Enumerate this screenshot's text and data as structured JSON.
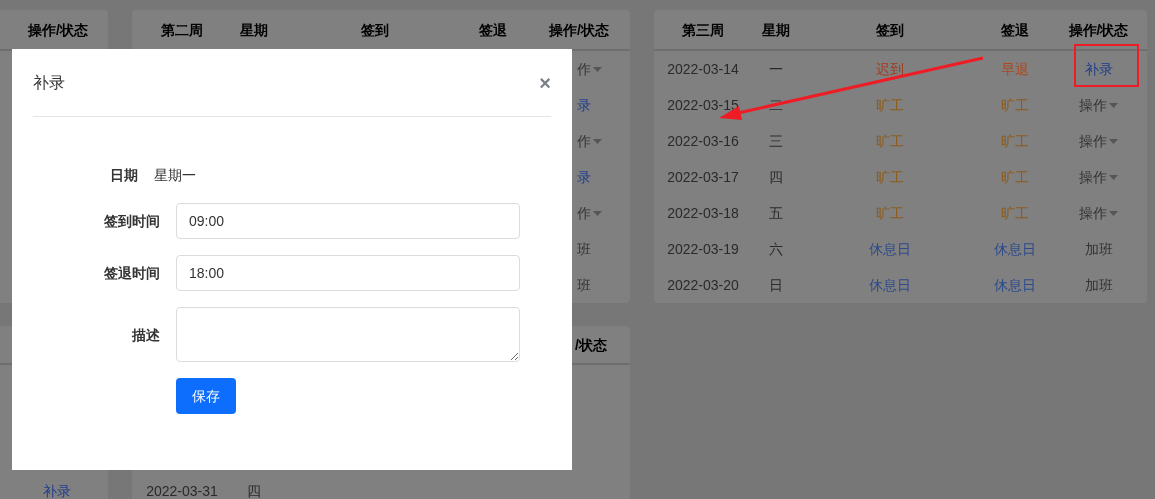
{
  "top_left_card": {
    "columns": [
      "操作/状态"
    ]
  },
  "week2_card": {
    "columns": [
      "第二周",
      "星期",
      "签到",
      "签退",
      "操作/状态"
    ],
    "rows": [
      {
        "action": "作",
        "kind": "menu"
      },
      {
        "action": "录",
        "kind": "link"
      },
      {
        "action": "作",
        "kind": "menu"
      },
      {
        "action": "录",
        "kind": "link"
      },
      {
        "action": "作",
        "kind": "menu"
      },
      {
        "action": "班",
        "kind": "plain"
      },
      {
        "action": "班",
        "kind": "plain"
      }
    ]
  },
  "week3_card": {
    "columns": [
      "第三周",
      "星期",
      "签到",
      "签退",
      "操作/状态"
    ],
    "rows": [
      {
        "date": "2022-03-14",
        "weekday": "一",
        "sign_in": {
          "text": "迟到",
          "kind": "late"
        },
        "sign_out": {
          "text": "早退",
          "kind": "early"
        },
        "action": {
          "text": "补录",
          "kind": "link"
        }
      },
      {
        "date": "2022-03-15",
        "weekday": "二",
        "sign_in": {
          "text": "旷工",
          "kind": "absent"
        },
        "sign_out": {
          "text": "旷工",
          "kind": "absent"
        },
        "action": {
          "text": "操作",
          "kind": "menu"
        }
      },
      {
        "date": "2022-03-16",
        "weekday": "三",
        "sign_in": {
          "text": "旷工",
          "kind": "absent"
        },
        "sign_out": {
          "text": "旷工",
          "kind": "absent"
        },
        "action": {
          "text": "操作",
          "kind": "menu"
        }
      },
      {
        "date": "2022-03-17",
        "weekday": "四",
        "sign_in": {
          "text": "旷工",
          "kind": "absent"
        },
        "sign_out": {
          "text": "旷工",
          "kind": "absent"
        },
        "action": {
          "text": "操作",
          "kind": "menu"
        }
      },
      {
        "date": "2022-03-18",
        "weekday": "五",
        "sign_in": {
          "text": "旷工",
          "kind": "absent"
        },
        "sign_out": {
          "text": "旷工",
          "kind": "absent"
        },
        "action": {
          "text": "操作",
          "kind": "menu"
        }
      },
      {
        "date": "2022-03-19",
        "weekday": "六",
        "sign_in": {
          "text": "休息日",
          "kind": "rest"
        },
        "sign_out": {
          "text": "休息日",
          "kind": "rest"
        },
        "action": {
          "text": "加班",
          "kind": "plain"
        }
      },
      {
        "date": "2022-03-20",
        "weekday": "日",
        "sign_in": {
          "text": "休息日",
          "kind": "rest"
        },
        "sign_out": {
          "text": "休息日",
          "kind": "rest"
        },
        "action": {
          "text": "加班",
          "kind": "plain"
        }
      }
    ]
  },
  "bottom_left_card": {
    "rows": [
      {
        "action": "补录",
        "kind": "link"
      }
    ]
  },
  "bottom_week_card": {
    "columns": [
      "/状态"
    ],
    "rows": [
      {
        "date": "2022-03-31",
        "weekday": "四"
      }
    ]
  },
  "dialog": {
    "title": "补录",
    "close": "×",
    "fields": [
      {
        "label": "日期",
        "kind": "text",
        "value": "星期一"
      },
      {
        "label": "签到时间",
        "kind": "input",
        "value": "09:00"
      },
      {
        "label": "签退时间",
        "kind": "input",
        "value": "18:00"
      },
      {
        "label": "描述",
        "kind": "textarea"
      }
    ],
    "save_button": "保存"
  }
}
